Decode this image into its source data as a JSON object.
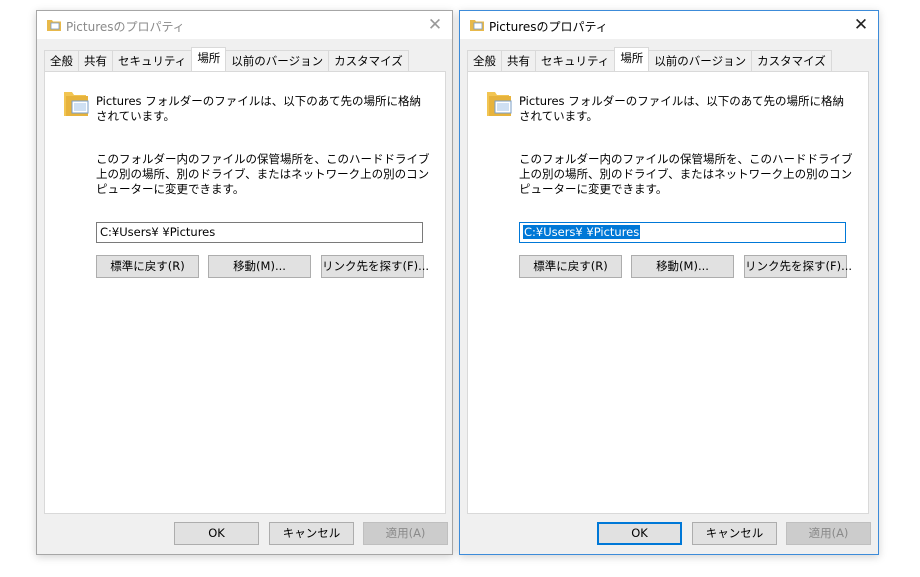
{
  "dialogs": [
    {
      "title": "Picturesのプロパティ",
      "tabs": [
        "全般",
        "共有",
        "セキュリティ",
        "場所",
        "以前のバージョン",
        "カスタマイズ"
      ],
      "active_tab": "場所",
      "description_1": "Pictures フォルダーのファイルは、以下のあて先の場所に格納されています。",
      "description_2": "このフォルダー内のファイルの保管場所を、このハードドライブ上の別の場所、別のドライブ、またはネットワーク上の別のコンピューターに変更できます。",
      "path_value": "C:¥Users¥    ¥Pictures",
      "path_selected": false,
      "buttons": {
        "restore": "標準に戻す(R)",
        "move": "移動(M)...",
        "find": "リンク先を探す(F)..."
      },
      "footer": {
        "ok": "OK",
        "cancel": "キャンセル",
        "apply": "適用(A)"
      },
      "active": false
    },
    {
      "title": "Picturesのプロパティ",
      "tabs": [
        "全般",
        "共有",
        "セキュリティ",
        "場所",
        "以前のバージョン",
        "カスタマイズ"
      ],
      "active_tab": "場所",
      "description_1": "Pictures フォルダーのファイルは、以下のあて先の場所に格納されています。",
      "description_2": "このフォルダー内のファイルの保管場所を、このハードドライブ上の別の場所、別のドライブ、またはネットワーク上の別のコンピューターに変更できます。",
      "path_value": "C:¥Users¥      ¥Pictures",
      "path_selected": true,
      "buttons": {
        "restore": "標準に戻す(R)",
        "move": "移動(M)...",
        "find": "リンク先を探す(F)..."
      },
      "footer": {
        "ok": "OK",
        "cancel": "キャンセル",
        "apply": "適用(A)"
      },
      "active": true
    }
  ],
  "colors": {
    "accent": "#0078d7",
    "window_bg": "#f0f0f0",
    "panel_bg": "#ffffff",
    "button_bg": "#e1e1e1"
  },
  "icons": [
    "pictures-folder-icon",
    "close-icon"
  ]
}
